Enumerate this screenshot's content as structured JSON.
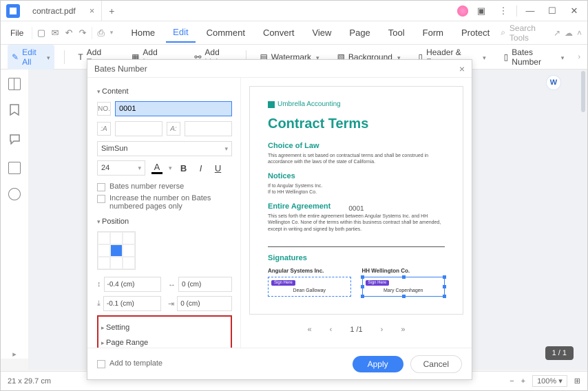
{
  "titlebar": {
    "filename": "contract.pdf"
  },
  "menu": {
    "file": "File",
    "items": [
      "Home",
      "Edit",
      "Comment",
      "Convert",
      "View",
      "Page",
      "Tool",
      "Form",
      "Protect"
    ],
    "active": 1,
    "search_placeholder": "Search Tools"
  },
  "toolbar": {
    "edit_all": "Edit All",
    "add_text": "Add Text",
    "add_image": "Add Image",
    "add_link": "Add Link",
    "watermark": "Watermark",
    "background": "Background",
    "header_footer": "Header & Footer",
    "bates_number": "Bates Number"
  },
  "modal": {
    "title": "Bates Number",
    "content_label": "Content",
    "number_value": "0001",
    "font": "SimSun",
    "size": "24",
    "reverse": "Bates number reverse",
    "increase": "Increase the number on Bates numbered pages only",
    "position_label": "Position",
    "offset1": "-0.4 (cm)",
    "offset2": "0 (cm)",
    "offset3": "-0.1 (cm)",
    "offset4": "0 (cm)",
    "setting": "Setting",
    "page_range": "Page Range",
    "add_template": "Add to template",
    "apply": "Apply",
    "cancel": "Cancel",
    "preview_page": "1 /1"
  },
  "doc": {
    "company": "Umbrella Accounting",
    "title": "Contract Terms",
    "s1": "Choice of Law",
    "s1_body": "This agreement is set based on contractual terms and shall be construed in accordance with the laws of the state of California.",
    "s2": "Notices",
    "s2_body1": "If to Angular Systems Inc.",
    "s2_body2": "If to HH Wellington Co.",
    "bates": "0001",
    "s3": "Entire Agreement",
    "s3_body": "This sets forth the entire agreement between Angular Systems Inc. and HH Wellington Co. None of the terms within this business contract shall be amended, except in writing and signed by both parties.",
    "s4": "Signatures",
    "party1": "Angular Systems Inc.",
    "party2": "HH Wellington Co.",
    "sign_here": "Sign Here",
    "signer1": "Dean Galloway",
    "signer2": "Mary Copenhagen"
  },
  "status": {
    "dims": "21 x 29.7 cm",
    "zoom": "100%"
  },
  "page_indicator": "1 / 1"
}
